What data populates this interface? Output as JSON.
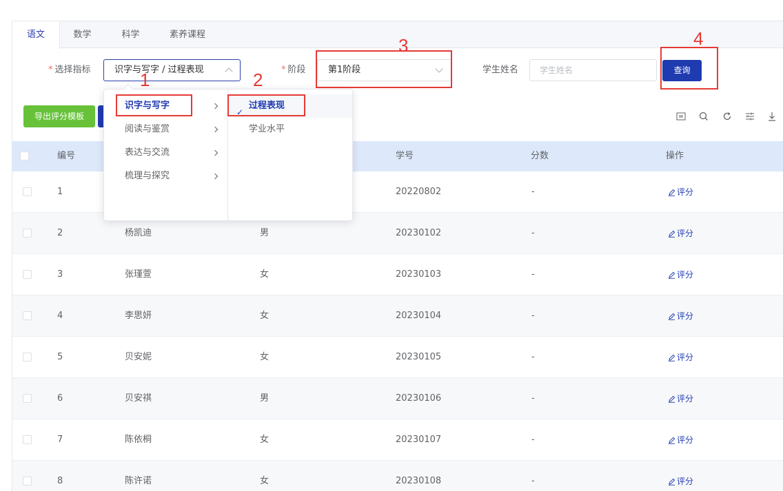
{
  "tabs": [
    {
      "label": "语文"
    },
    {
      "label": "数学"
    },
    {
      "label": "科学"
    },
    {
      "label": "素养课程"
    }
  ],
  "filters": {
    "indicator_label": "选择指标",
    "indicator_value": "识字与写字 / 过程表现",
    "stage_label": "阶段",
    "stage_value": "第1阶段",
    "name_label": "学生姓名",
    "name_placeholder": "学生姓名",
    "required_mark": "*",
    "query_button": "查询"
  },
  "toolbar": {
    "export_button": "导出评分模板",
    "icons": [
      "columns-icon",
      "search-icon",
      "refresh-icon",
      "filter-icon",
      "download-icon"
    ]
  },
  "cascader": {
    "level1": [
      {
        "label": "识字与写字",
        "active": true
      },
      {
        "label": "阅读与鉴赏"
      },
      {
        "label": "表达与交流"
      },
      {
        "label": "梳理与探究"
      }
    ],
    "level2": [
      {
        "label": "过程表现",
        "selected": true,
        "check": "✓"
      },
      {
        "label": "学业水平"
      }
    ]
  },
  "table": {
    "headers": {
      "no": "编号",
      "studentno": "学号",
      "score": "分数",
      "ops": "操作"
    },
    "op_label": "评分",
    "rows": [
      {
        "no": "1",
        "name": "",
        "gender": "",
        "studentno": "20220802",
        "score": "-"
      },
      {
        "no": "2",
        "name": "杨凯迪",
        "gender": "男",
        "studentno": "20230102",
        "score": "-"
      },
      {
        "no": "3",
        "name": "张瑾萱",
        "gender": "女",
        "studentno": "20230103",
        "score": "-"
      },
      {
        "no": "4",
        "name": "李思妍",
        "gender": "女",
        "studentno": "20230104",
        "score": "-"
      },
      {
        "no": "5",
        "name": "贝安妮",
        "gender": "女",
        "studentno": "20230105",
        "score": "-"
      },
      {
        "no": "6",
        "name": "贝安祺",
        "gender": "男",
        "studentno": "20230106",
        "score": "-"
      },
      {
        "no": "7",
        "name": "陈依桐",
        "gender": "女",
        "studentno": "20230107",
        "score": "-"
      },
      {
        "no": "8",
        "name": "陈许诺",
        "gender": "女",
        "studentno": "20230108",
        "score": "-"
      }
    ]
  },
  "annotations": [
    "1",
    "2",
    "3",
    "4"
  ],
  "colors": {
    "primary": "#1f3bb0",
    "success": "#67c23a",
    "annotation": "#e53935",
    "header_bg": "#dde9fb"
  }
}
